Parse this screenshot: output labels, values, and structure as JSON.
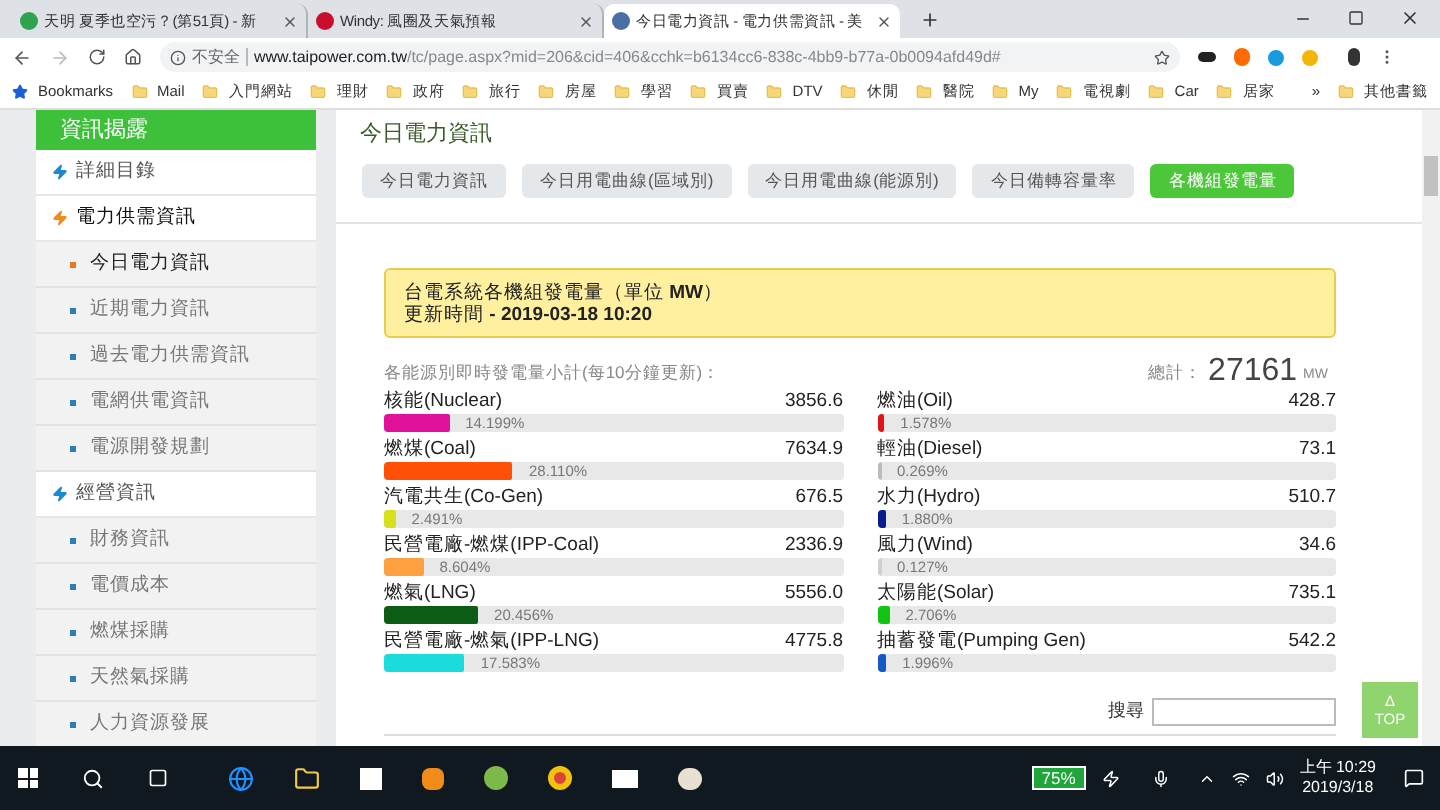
{
  "browser": {
    "tabs": [
      {
        "title": "天明 夏季也空污？(第51頁) - 新",
        "selected": false,
        "color": "#2ea44f"
      },
      {
        "title": "Windy: 風圈及天氣預報",
        "selected": false,
        "color": "#c8102e"
      },
      {
        "title": "今日電力資訊 - 電力供需資訊 - 美",
        "selected": true,
        "color": "#4a6fa5"
      }
    ],
    "security": "不安全",
    "url_host": "www.taipower.com.tw",
    "url_path": "/tc/page.aspx?mid=206&cid=406&cchk=b6134cc6-838c-4bb9-b77a-0b0094afd49d#",
    "bookmarks": [
      "Bookmarks",
      "Mail",
      "入門網站",
      "理財",
      "政府",
      "旅行",
      "房屋",
      "學習",
      "買賣",
      "DTV",
      "休閒",
      "醫院",
      "My",
      "電視劇",
      "Car",
      "居家"
    ],
    "bookmarks_more": "»",
    "other_bookmarks": "其他書籤"
  },
  "sidebar": {
    "header": "資訊揭露",
    "items": [
      {
        "label": "詳細目錄",
        "selected": false
      },
      {
        "label": "電力供需資訊",
        "selected": true,
        "children": [
          {
            "label": "今日電力資訊",
            "selected": true
          },
          {
            "label": "近期電力資訊",
            "selected": false
          },
          {
            "label": "過去電力供需資訊",
            "selected": false
          },
          {
            "label": "電網供電資訊",
            "selected": false
          },
          {
            "label": "電源開發規劃",
            "selected": false
          }
        ]
      },
      {
        "label": "經營資訊",
        "selected": false,
        "children": [
          {
            "label": "財務資訊",
            "selected": false
          },
          {
            "label": "電價成本",
            "selected": false
          },
          {
            "label": "燃煤採購",
            "selected": false
          },
          {
            "label": "天然氣採購",
            "selected": false
          },
          {
            "label": "人力資源發展",
            "selected": false
          }
        ]
      }
    ]
  },
  "page_title": "今日電力資訊",
  "buttons": [
    {
      "label": "今日電力資訊",
      "selected": false
    },
    {
      "label": "今日用電曲線(區域別)",
      "selected": false
    },
    {
      "label": "今日用電曲線(能源別)",
      "selected": false
    },
    {
      "label": "今日備轉容量率",
      "selected": false
    },
    {
      "label": "各機組發電量",
      "selected": true
    }
  ],
  "notice": {
    "title": "台電系統各機組發電量（單位 **MW**）",
    "updated": "更新時間 **- 2019-03-18 10:20**"
  },
  "subtitle": "各能源別即時發電量小計(每10分鐘更新)：",
  "total": {
    "label": "總計：",
    "value": "27161",
    "unit": "MW"
  },
  "sources_left": [
    {
      "name": "核能(Nuclear)",
      "value": "3856.6",
      "percent": "14.199%",
      "level": 0.142,
      "color": "#e0129c"
    },
    {
      "name": "燃煤(Coal)",
      "value": "7634.9",
      "percent": "28.110%",
      "level": 0.281,
      "color": "#ff5008"
    },
    {
      "name": "汽電共生(Co-Gen)",
      "value": "676.5",
      "percent": "2.491%",
      "level": 0.025,
      "color": "#d8e01a"
    },
    {
      "name": "民營電廠-燃煤(IPP-Coal)",
      "value": "2336.9",
      "percent": "8.604%",
      "level": 0.086,
      "color": "#ffa040"
    },
    {
      "name": "燃氣(LNG)",
      "value": "5556.0",
      "percent": "20.456%",
      "level": 0.205,
      "color": "#0b5d15"
    },
    {
      "name": "民營電廠-燃氣(IPP-LNG)",
      "value": "4775.8",
      "percent": "17.583%",
      "level": 0.176,
      "color": "#1bdcdc"
    }
  ],
  "sources_right": [
    {
      "name": "燃油(Oil)",
      "value": "428.7",
      "percent": "1.578%",
      "level": 0.016,
      "color": "#e01414"
    },
    {
      "name": "輕油(Diesel)",
      "value": "73.1",
      "percent": "0.269%",
      "level": 0.003,
      "color": "#bbbbbb"
    },
    {
      "name": "水力(Hydro)",
      "value": "510.7",
      "percent": "1.880%",
      "level": 0.019,
      "color": "#0a1a8c"
    },
    {
      "name": "風力(Wind)",
      "value": "34.6",
      "percent": "0.127%",
      "level": 0.001,
      "color": "#d0d0d0"
    },
    {
      "name": "太陽能(Solar)",
      "value": "735.1",
      "percent": "2.706%",
      "level": 0.027,
      "color": "#12c412"
    },
    {
      "name": "抽蓄發電(Pumping Gen)",
      "value": "542.2",
      "percent": "1.996%",
      "level": 0.02,
      "color": "#1458c8"
    }
  ],
  "search_label": "搜尋",
  "top_button": {
    "arrow": "Δ",
    "label": "TOP"
  },
  "taskbar": {
    "battery": "75%",
    "time": "上午 10:29",
    "date": "2019/3/18"
  }
}
